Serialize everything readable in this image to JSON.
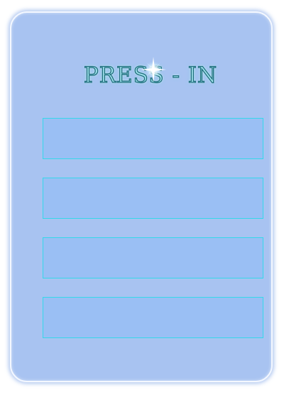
{
  "logo": {
    "text": "PRESS - IN"
  },
  "icons": {
    "sparkle": "sparkle-icon"
  },
  "colors": {
    "panel_background": "#a8c3f1",
    "box_background": "#9abff4",
    "box_border": "#35d8ea",
    "logo_fill": "#9fe0ea",
    "logo_outline": "#1f6f7d"
  },
  "boxes": [
    {
      "label": ""
    },
    {
      "label": ""
    },
    {
      "label": ""
    },
    {
      "label": ""
    }
  ]
}
